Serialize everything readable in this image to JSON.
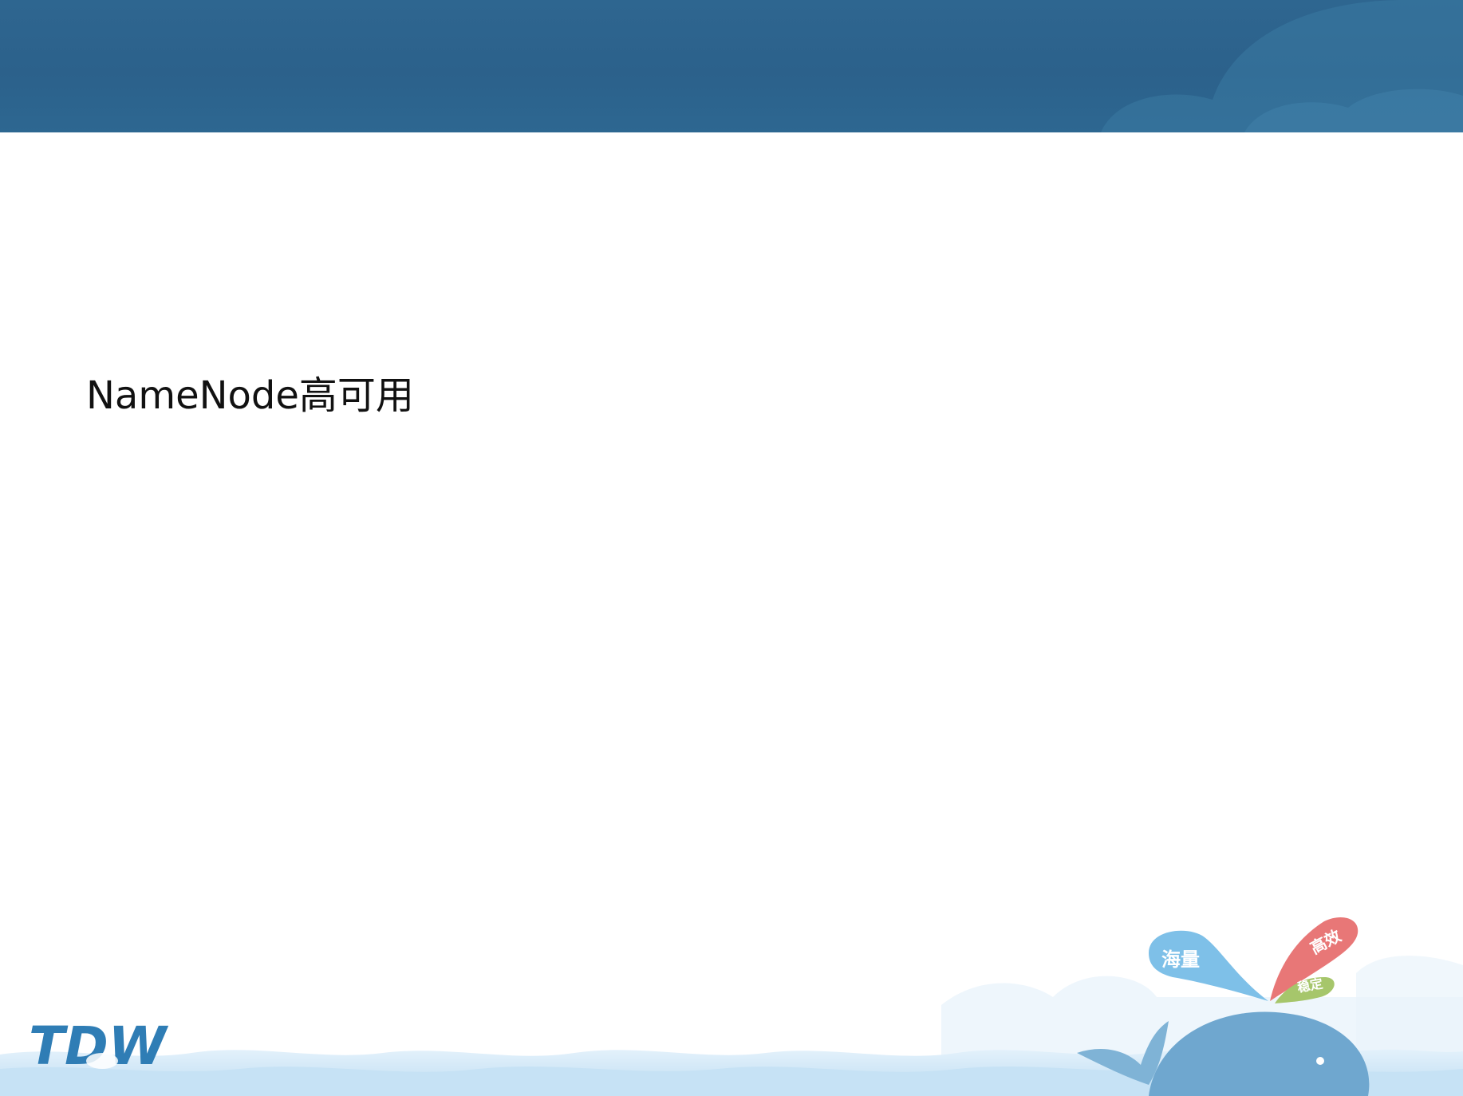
{
  "slide": {
    "title": "NameNode高可用"
  },
  "branding": {
    "logo_text": "TDW",
    "bubble_labels": [
      "海量",
      "高效",
      "稳定"
    ]
  },
  "colors": {
    "header": "#2c618b",
    "title_text": "#111111",
    "water": "#cfe6f6",
    "bubble_blue": "#7ec0e8",
    "bubble_red": "#e87777",
    "bubble_green": "#a6c66b",
    "whale": "#6fa7cf"
  }
}
